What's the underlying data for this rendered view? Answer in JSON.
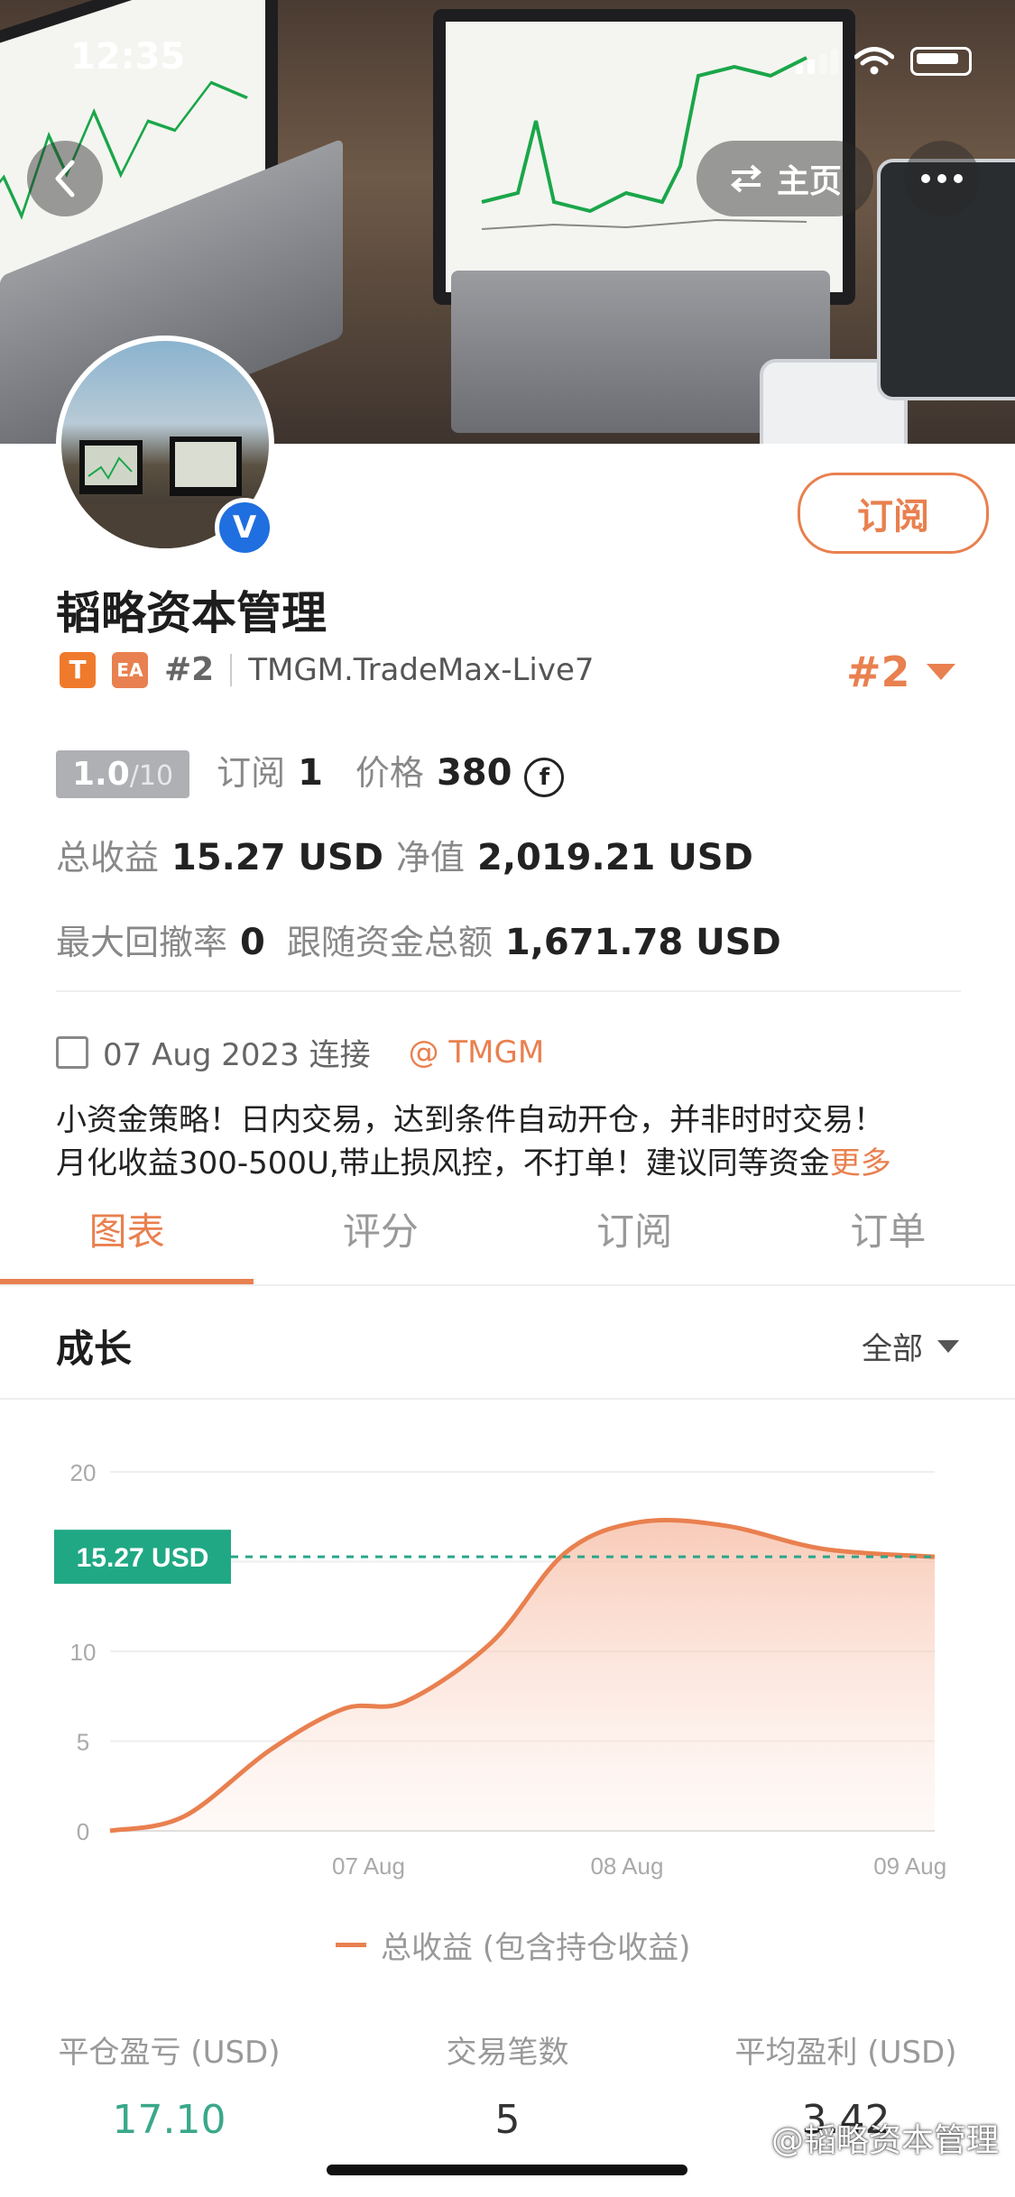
{
  "status": {
    "time": "12:35"
  },
  "nav": {
    "home_label": "主页",
    "back_icon": "chevron-left-icon",
    "more_icon": "ellipsis-icon"
  },
  "profile": {
    "name": "韬略资本管理",
    "tag_t": "T",
    "tag_ea": "EA",
    "rank_small": "#2",
    "account": "TMGM.TradeMax-Live7",
    "rank_big": "#2",
    "subscribe_label": "订阅",
    "verified_glyph": "V"
  },
  "metrics": {
    "score": "1.0",
    "score_max": "/10",
    "subscribe_label": "订阅",
    "subscribe_count": "1",
    "price_label": "价格",
    "price_value": "380",
    "total_profit_label": "总收益",
    "total_profit_value": "15.27 USD",
    "equity_label": "净值",
    "equity_value": "2,019.21 USD",
    "max_drawdown_label": "最大回撤率",
    "max_drawdown_value": "0",
    "follow_label": "跟随资金总额",
    "follow_value": "1,671.78 USD"
  },
  "connect": {
    "date_text": "07 Aug 2023 连接",
    "broker": "@ TMGM"
  },
  "description": {
    "line1": "小资金策略！日内交易，达到条件自动开仓，并非时时交易！",
    "line2": "月化收益300-500U,带止损风控，不打单！建议同等资金",
    "more": "更多"
  },
  "tabs": [
    "图表",
    "评分",
    "订阅",
    "订单"
  ],
  "section": {
    "title": "成长",
    "filter": "全部"
  },
  "chart_data": {
    "type": "area",
    "y_ticks": [
      "20",
      "15.27 USD",
      "10",
      "5",
      "0"
    ],
    "x_ticks": [
      "07 Aug",
      "08 Aug",
      "09 Aug"
    ],
    "ylim": [
      0,
      20
    ],
    "current_value_label": "15.27 USD",
    "current_value": 15.27,
    "series": [
      {
        "name": "总收益 (包含持仓收益)",
        "points": [
          [
            0,
            0
          ],
          [
            0.6,
            0.8
          ],
          [
            1.3,
            4.5
          ],
          [
            1.9,
            6.8
          ],
          [
            2.4,
            7.2
          ],
          [
            3.1,
            10.5
          ],
          [
            3.7,
            15.5
          ],
          [
            4.3,
            17.2
          ],
          [
            5.0,
            17.0
          ],
          [
            5.8,
            15.7
          ],
          [
            6.7,
            15.27
          ]
        ]
      }
    ],
    "x_tick_positions": [
      2.1,
      4.2,
      6.5
    ],
    "xlim": [
      0,
      6.7
    ],
    "legend": "bottom",
    "grid": true
  },
  "stats": [
    {
      "label": "平仓盈亏 (USD)",
      "value": "17.10"
    },
    {
      "label": "交易笔数",
      "value": "5"
    },
    {
      "label": "平均盈利 (USD)",
      "value": "3.42"
    }
  ],
  "watermark": "@韬略资本管理"
}
